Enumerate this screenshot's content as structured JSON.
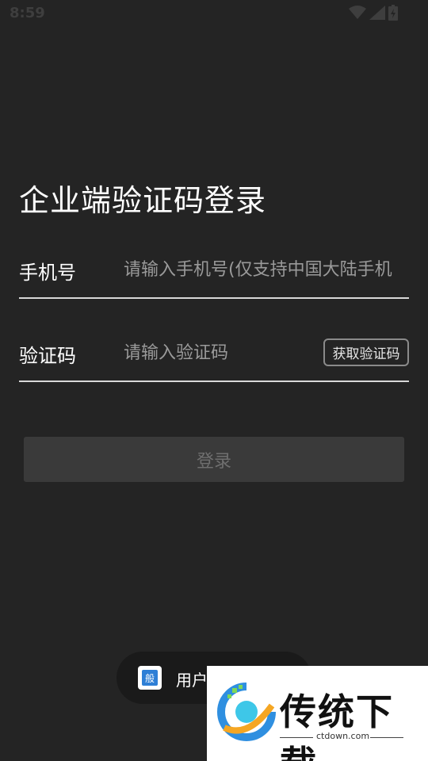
{
  "status_bar": {
    "time": "8:59",
    "icons": [
      "wifi-icon",
      "signal-icon",
      "battery-icon"
    ]
  },
  "page": {
    "title": "企业端验证码登录"
  },
  "phone_field": {
    "label": "手机号",
    "placeholder": "请输入手机号(仅支持中国大陆手机",
    "value": ""
  },
  "code_field": {
    "label": "验证码",
    "placeholder": "请输入验证码",
    "value": "",
    "get_code_label": "获取验证码"
  },
  "login_button": {
    "label": "登录"
  },
  "toast": {
    "text": "用户",
    "icon_char": "般"
  },
  "watermark": {
    "title": "传统下载",
    "url": "ctdown.com"
  },
  "colors": {
    "background": "#242424",
    "login_disabled_bg": "#3a3a3a",
    "underline": "#d8d8d8"
  }
}
